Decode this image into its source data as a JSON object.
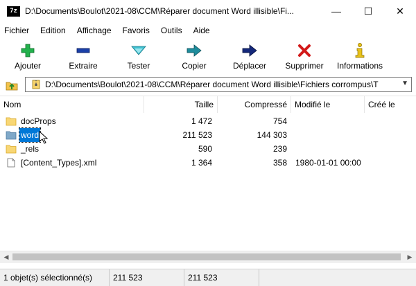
{
  "window": {
    "title": "D:\\Documents\\Boulot\\2021-08\\CCM\\Réparer document Word illisible\\Fi...",
    "app_icon_text": "7z",
    "controls": {
      "minimize": "—",
      "maximize": "☐",
      "close": "✕"
    }
  },
  "menu": [
    "Fichier",
    "Edition",
    "Affichage",
    "Favoris",
    "Outils",
    "Aide"
  ],
  "toolbar": [
    {
      "label": "Ajouter",
      "icon": "plus-icon",
      "color": "#22b14c"
    },
    {
      "label": "Extraire",
      "icon": "minus-icon",
      "color": "#1a3fa8"
    },
    {
      "label": "Tester",
      "icon": "check-icon",
      "color": "#3fbfcf"
    },
    {
      "label": "Copier",
      "icon": "copy-arrow-icon",
      "color": "#1e8c9c"
    },
    {
      "label": "Déplacer",
      "icon": "move-arrow-icon",
      "color": "#14287a"
    },
    {
      "label": "Supprimer",
      "icon": "delete-icon",
      "color": "#d21a1a"
    },
    {
      "label": "Informations",
      "icon": "info-icon",
      "color": "#e8c21a"
    }
  ],
  "address": {
    "path": "D:\\Documents\\Boulot\\2021-08\\CCM\\Réparer document Word illisible\\Fichiers corrompus\\T"
  },
  "columns": [
    "Nom",
    "Taille",
    "Compressé",
    "Modifié le",
    "Créé le"
  ],
  "rows": [
    {
      "name": "docProps",
      "type": "folder",
      "size": "1 472",
      "packed": "754",
      "modified": ""
    },
    {
      "name": "word",
      "type": "folder",
      "size": "211 523",
      "packed": "144 303",
      "modified": "",
      "selected": true
    },
    {
      "name": "_rels",
      "type": "folder",
      "size": "590",
      "packed": "239",
      "modified": ""
    },
    {
      "name": "[Content_Types].xml",
      "type": "file",
      "size": "1 364",
      "packed": "358",
      "modified": "1980-01-01 00:00"
    }
  ],
  "status": {
    "selection": "1 objet(s) sélectionné(s)",
    "size": "211 523",
    "packed": "211 523"
  }
}
